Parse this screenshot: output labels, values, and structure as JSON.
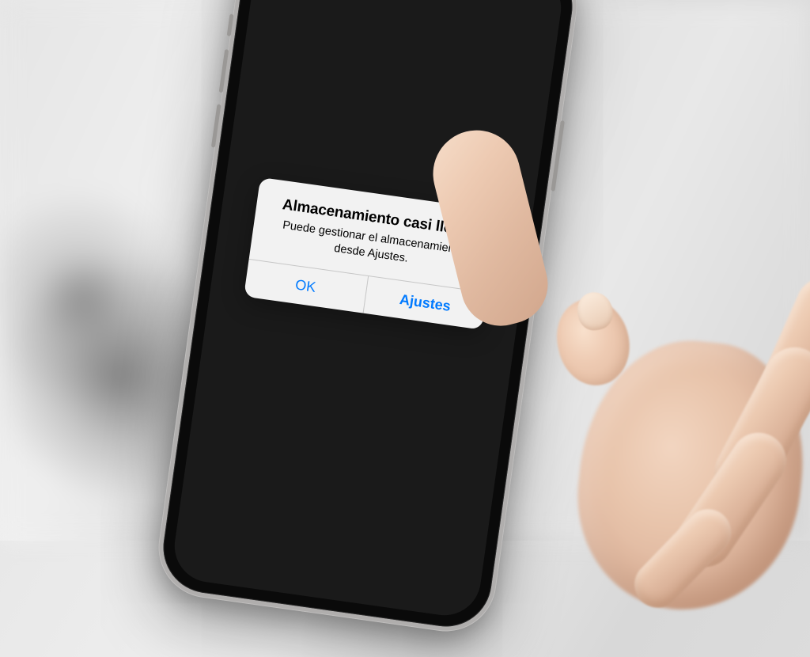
{
  "alert": {
    "title": "Almacenamiento casi lleno",
    "message": "Puede gestionar el almacenamiento desde Ajustes.",
    "buttons": {
      "ok": "OK",
      "settings": "Ajustes"
    }
  }
}
